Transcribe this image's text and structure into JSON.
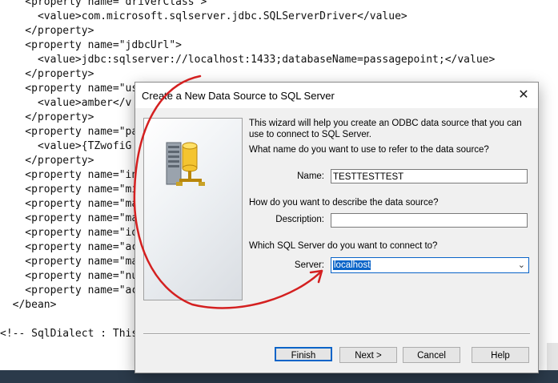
{
  "background_code": {
    "lines": [
      "    <property name=\"driverClass\">",
      "      <value>com.microsoft.sqlserver.jdbc.SQLServerDriver</value>",
      "    </property>",
      "    <property name=\"jdbcUrl\">",
      "      <value>jdbc:sqlserver://localhost:1433;databaseName=passagepoint;</value>",
      "    </property>",
      "    <property name=\"use",
      "      <value>amber</v",
      "    </property>",
      "    <property name=\"pas",
      "      <value>{TZwofiG",
      "    </property>",
      "    <property name=\"ini",
      "    <property name=\"min",
      "    <property name=\"max",
      "    <property name=\"max",
      "    <property name=\"idl",
      "    <property name=\"acq",
      "    <property name=\"max",
      "    <property name=\"num",
      "    <property name=\"acq",
      "  </bean>",
      "",
      "<!-- SqlDialect : This"
    ]
  },
  "dialog": {
    "title": "Create a New Data Source to SQL Server",
    "intro": "This wizard will help you create an ODBC data source that you can use to connect to SQL Server.",
    "q_name": "What name do you want to use to refer to the data source?",
    "name_label": "Name:",
    "name_value": "TESTTESTTEST",
    "q_desc": "How do you want to describe the data source?",
    "desc_label": "Description:",
    "desc_value": "",
    "q_server": "Which SQL Server do you want to connect to?",
    "server_label": "Server:",
    "server_value": "localhost",
    "buttons": {
      "finish": "Finish",
      "next": "Next >",
      "cancel": "Cancel",
      "help": "Help"
    }
  },
  "colors": {
    "annotation": "#d42020",
    "selection": "#0a64c8",
    "dialog_bg": "#f0f0f0"
  },
  "icons": {
    "close": "close-icon",
    "chevron": "chevron-down-icon",
    "art": "server-database-icon"
  }
}
